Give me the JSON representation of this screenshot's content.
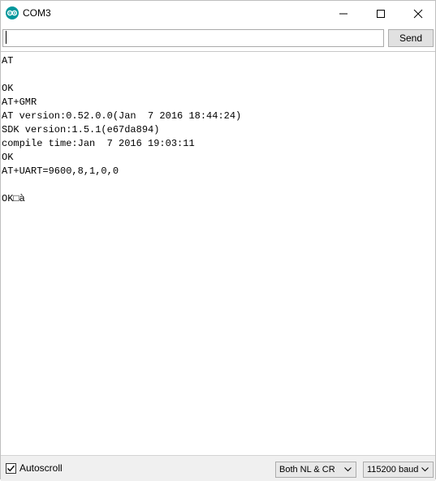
{
  "window": {
    "title": "COM3"
  },
  "send_bar": {
    "input_value": "",
    "send_label": "Send"
  },
  "output": {
    "lines": [
      "AT",
      "",
      "OK",
      "AT+GMR",
      "AT version:0.52.0.0(Jan  7 2016 18:44:24)",
      "SDK version:1.5.1(e67da894)",
      "compile time:Jan  7 2016 19:03:11",
      "OK",
      "AT+UART=9600,8,1,0,0",
      "",
      "OK□à"
    ]
  },
  "footer": {
    "autoscroll_label": "Autoscroll",
    "autoscroll_checked": true,
    "line_ending": "Both NL & CR",
    "baud_rate": "115200 baud"
  },
  "colors": {
    "arduino_teal": "#00979c",
    "bottom_bar": "#f0f0f0",
    "button_face": "#e1e1e1"
  }
}
